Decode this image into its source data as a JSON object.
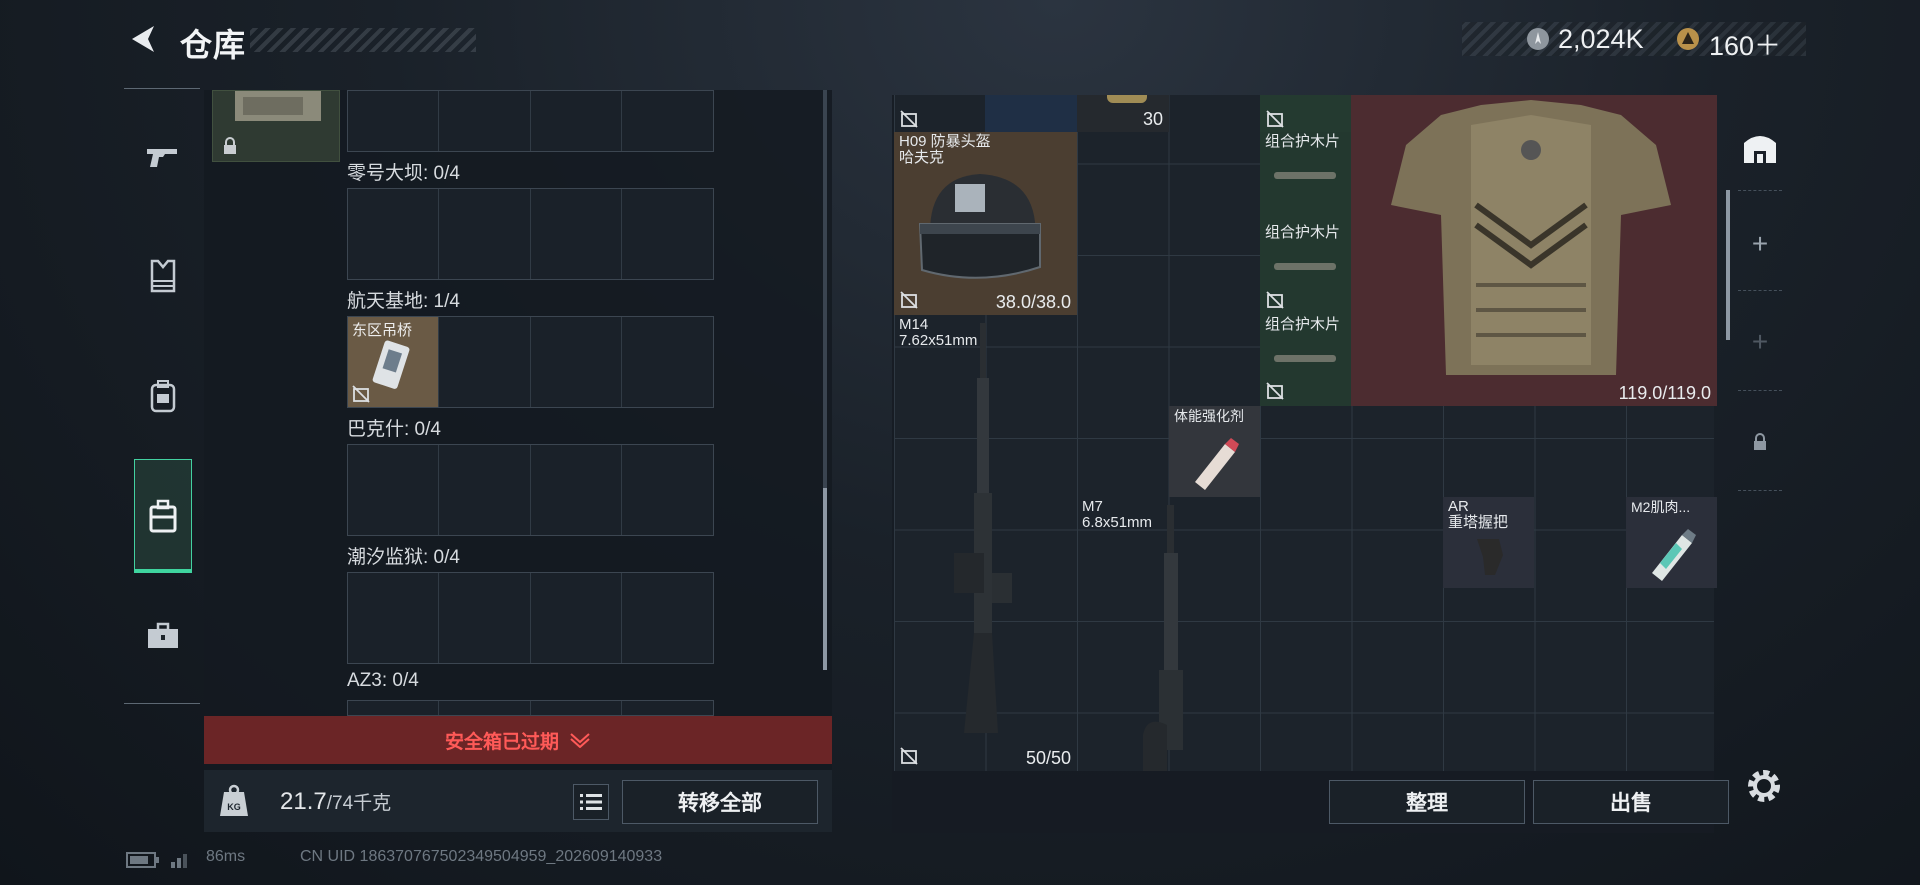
{
  "header": {
    "title": "仓库",
    "currency_silver": "2,024K",
    "currency_gold": "160＋"
  },
  "left_panel": {
    "cases": [
      {
        "label": "零号大坝: 0/4"
      },
      {
        "label": "航天基地: 1/4"
      },
      {
        "label": "巴克什: 0/4"
      },
      {
        "label": "潮汐监狱: 0/4"
      },
      {
        "label": "AZ3: 0/4"
      }
    ],
    "east_bridge_item": "东区吊桥",
    "expired_text": "安全箱已过期",
    "weight_current": "21.7",
    "weight_max": "/74千克",
    "transfer_all": "转移全部"
  },
  "grid_items": {
    "top_count": "30",
    "helmet": {
      "name_line1": "H09 防暴头盔",
      "name_line2": "哈夫克",
      "durability": "38.0/38.0"
    },
    "armor_plate_1": "组合护木片",
    "armor_plate_2": "组合护木片",
    "armor_plate_3": "组合护木片",
    "vest_durability": "119.0/119.0",
    "m14": {
      "name": "M14",
      "caliber": "7.62x51mm",
      "ammo": "50/50"
    },
    "stim": "体能强化剂",
    "m7": {
      "name": "M7",
      "caliber": "6.8x51mm"
    },
    "grip": {
      "line1": "AR",
      "line2": "重塔握把"
    },
    "m2": "M2肌肉..."
  },
  "actions": {
    "sort": "整理",
    "sell": "出售"
  },
  "footer": {
    "ping": "86ms",
    "uid": "CN UID 1863707675023495049​59_202609140933"
  }
}
